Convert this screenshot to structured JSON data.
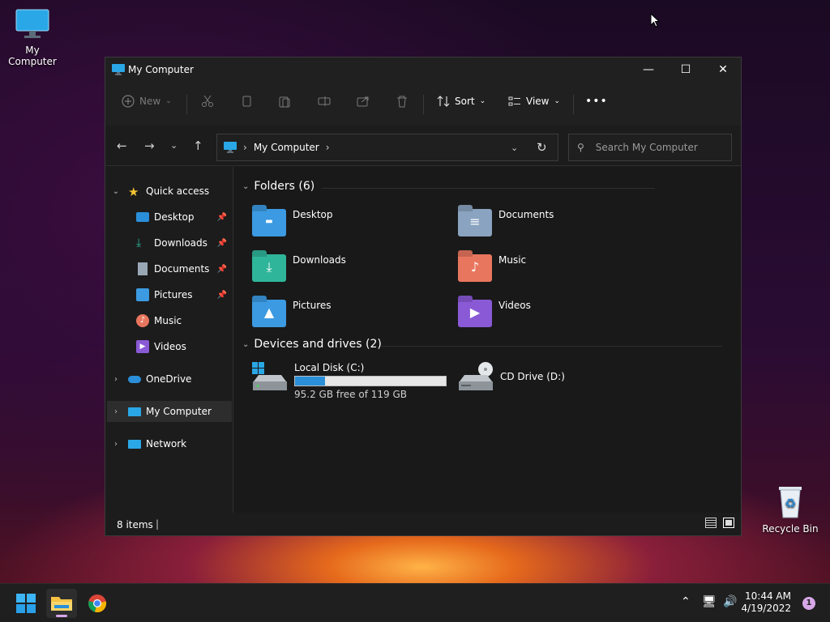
{
  "desktop": {
    "icons": [
      {
        "label": "My Computer"
      },
      {
        "label": "Recycle Bin"
      }
    ]
  },
  "window": {
    "title": "My Computer",
    "controls": {
      "minimize": "—",
      "maximize": "☐",
      "close": "✕"
    }
  },
  "toolbar": {
    "new_label": "New",
    "sort_label": "Sort",
    "view_label": "View",
    "more_label": "•••"
  },
  "navbar": {
    "address": "My Computer",
    "search_placeholder": "Search My Computer"
  },
  "sidebar": {
    "items": [
      {
        "label": "Quick access"
      },
      {
        "label": "Desktop"
      },
      {
        "label": "Downloads"
      },
      {
        "label": "Documents"
      },
      {
        "label": "Pictures"
      },
      {
        "label": "Music"
      },
      {
        "label": "Videos"
      },
      {
        "label": "OneDrive"
      },
      {
        "label": "My Computer"
      },
      {
        "label": "Network"
      }
    ]
  },
  "content": {
    "folders_heading": "Folders (6)",
    "folders": [
      {
        "label": "Desktop",
        "color": "#3b9ae1"
      },
      {
        "label": "Documents",
        "color": "#8aa3c0"
      },
      {
        "label": "Downloads",
        "color": "#2fb59a"
      },
      {
        "label": "Music",
        "color": "#e8765e"
      },
      {
        "label": "Pictures",
        "color": "#3b9ae1"
      },
      {
        "label": "Videos",
        "color": "#8a5ad6"
      }
    ],
    "drives_heading": "Devices and drives (2)",
    "drives": [
      {
        "label": "Local Disk (C:)",
        "free_text": "95.2 GB free of 119 GB",
        "used_fraction": 0.2
      },
      {
        "label": "CD Drive (D:)"
      }
    ]
  },
  "status": {
    "items_count": "8 items"
  },
  "taskbar": {
    "clock_time": "10:44 AM",
    "clock_date": "4/19/2022",
    "notification_count": "1"
  }
}
